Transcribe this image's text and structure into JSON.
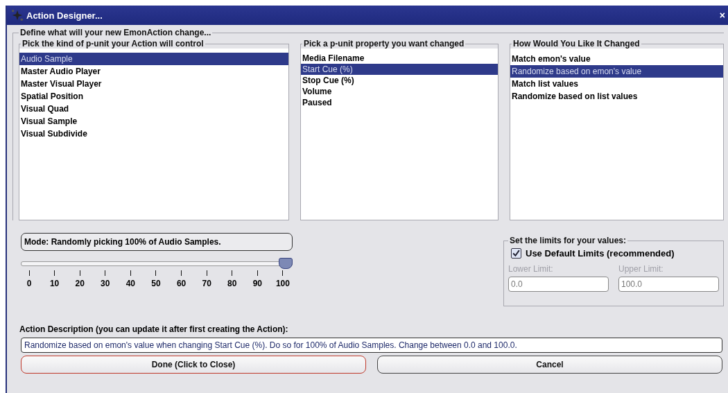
{
  "window": {
    "title": "Action Designer...",
    "close": "×"
  },
  "outer_group": {
    "title": "Define what will your new EmonAction change..."
  },
  "lists": [
    {
      "title": "Pick the kind of p-unit your Action will control",
      "items": [
        {
          "label": "Audio Sample",
          "selected": true
        },
        {
          "label": "Master Audio Player",
          "selected": false
        },
        {
          "label": "Master Visual Player",
          "selected": false
        },
        {
          "label": "Spatial Position",
          "selected": false
        },
        {
          "label": "Visual Quad",
          "selected": false
        },
        {
          "label": "Visual Sample",
          "selected": false
        },
        {
          "label": "Visual Subdivide",
          "selected": false
        }
      ]
    },
    {
      "title": "Pick a p-unit property you want changed",
      "items": [
        {
          "label": "Media Filename",
          "selected": false
        },
        {
          "label": "Start Cue (%)",
          "selected": true
        },
        {
          "label": "Stop Cue (%)",
          "selected": false
        },
        {
          "label": "Volume",
          "selected": false
        },
        {
          "label": "Paused",
          "selected": false
        }
      ]
    },
    {
      "title": "How Would You Like It Changed",
      "items": [
        {
          "label": "Match emon's value",
          "selected": false
        },
        {
          "label": "Randomize based on emon's value",
          "selected": true
        },
        {
          "label": "Match list values",
          "selected": false
        },
        {
          "label": "Randomize based on list values",
          "selected": false
        }
      ]
    }
  ],
  "mode": {
    "label": "Mode: Randomly picking 100% of Audio Samples."
  },
  "slider": {
    "level": 1.0,
    "ticks": [
      "0",
      "10",
      "20",
      "30",
      "40",
      "50",
      "60",
      "70",
      "80",
      "90",
      "100"
    ]
  },
  "limits": {
    "title": "Set the limits for your values:",
    "checkbox": {
      "label": "Use Default Limits (recommended)",
      "checked": true
    },
    "fields": [
      {
        "label": "Lower Limit:",
        "value": "0.0",
        "disabled": true
      },
      {
        "label": "Upper Limit:",
        "value": "100.0",
        "disabled": true
      }
    ]
  },
  "description": {
    "label": "Action Description (you can update it after first creating the Action):",
    "value": "Randomize based on emon's value when changing Start Cue (%). Do so for 100% of Audio Samples. Change between 0.0 and 100.0."
  },
  "buttons": [
    {
      "label": "Done (Click to Close)",
      "default": true
    },
    {
      "label": "Cancel",
      "default": false
    }
  ]
}
